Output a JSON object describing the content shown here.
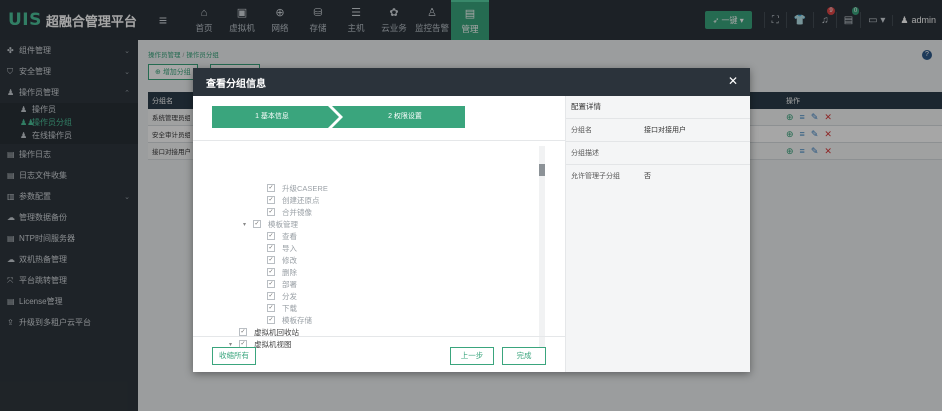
{
  "brand": {
    "logo": "UIS",
    "title": "超融合管理平台"
  },
  "topnav": [
    {
      "label": "首页",
      "icon": "home-icon",
      "glyph": "⌂"
    },
    {
      "label": "虚拟机",
      "icon": "vm-icon",
      "glyph": "▣"
    },
    {
      "label": "网络",
      "icon": "network-icon",
      "glyph": "⊕"
    },
    {
      "label": "存储",
      "icon": "storage-icon",
      "glyph": "⛁"
    },
    {
      "label": "主机",
      "icon": "host-icon",
      "glyph": "☰"
    },
    {
      "label": "云业务",
      "icon": "cloud-icon",
      "glyph": "✿"
    },
    {
      "label": "监控告警",
      "icon": "alarm-icon",
      "glyph": "♙"
    },
    {
      "label": "管理",
      "icon": "manage-icon",
      "glyph": "▤",
      "active": true
    }
  ],
  "topright": {
    "onekey_label": "一键",
    "shirt_badge": "",
    "bell_badge": "9",
    "msg_badge": "0",
    "user": "admin"
  },
  "sidebar": {
    "items": [
      {
        "label": "组件管理",
        "icon": "component-icon",
        "glyph": "✤",
        "chevron": "⌄"
      },
      {
        "label": "安全管理",
        "icon": "security-icon",
        "glyph": "⛉",
        "chevron": "⌄"
      },
      {
        "label": "操作员管理",
        "icon": "operator-icon",
        "glyph": "♟",
        "chevron": "⌃"
      },
      {
        "label": "日志文件收集",
        "icon": "logfile-icon",
        "glyph": "▤"
      },
      {
        "label": "参数配置",
        "icon": "config-icon",
        "glyph": "▥",
        "chevron": "⌄"
      },
      {
        "label": "管理数据备份",
        "icon": "backup-icon",
        "glyph": "☁"
      },
      {
        "label": "NTP时间服务器",
        "icon": "ntp-icon",
        "glyph": "▤"
      },
      {
        "label": "双机热备管理",
        "icon": "ha-icon",
        "glyph": "☁"
      },
      {
        "label": "平台跳转管理",
        "icon": "jump-icon",
        "glyph": "⤧"
      },
      {
        "label": "License管理",
        "icon": "license-icon",
        "glyph": "▤"
      },
      {
        "label": "升级到多租户云平台",
        "icon": "upgrade-icon",
        "glyph": "⇪"
      }
    ],
    "sub": [
      {
        "label": "操作员",
        "glyph": "♟"
      },
      {
        "label": "操作员分组",
        "glyph": "♟♟",
        "active": true
      },
      {
        "label": "在线操作员",
        "glyph": "♟"
      }
    ],
    "log": {
      "label": "操作日志",
      "glyph": "▤"
    }
  },
  "main": {
    "breadcrumb": [
      "操作员管理",
      "操作员分组"
    ],
    "add_label": "增加分组",
    "table_header": "分组名",
    "op_header": "操作",
    "rows": [
      "系统管理员组",
      "安全审计员组",
      "接口对接用户"
    ]
  },
  "modal": {
    "title": "查看分组信息",
    "step1": "1 基本信息",
    "step2": "2 权限设置",
    "tree": [
      {
        "label": "升级CASERE",
        "indent": 2,
        "checked": true
      },
      {
        "label": "创建还原点",
        "indent": 2,
        "checked": true
      },
      {
        "label": "合并镜像",
        "indent": 2,
        "checked": true
      },
      {
        "label": "模板管理",
        "indent": 1,
        "checked": true,
        "toggle": "▾"
      },
      {
        "label": "查看",
        "indent": 2,
        "checked": true
      },
      {
        "label": "导入",
        "indent": 2,
        "checked": true
      },
      {
        "label": "修改",
        "indent": 2,
        "checked": true
      },
      {
        "label": "删除",
        "indent": 2,
        "checked": true
      },
      {
        "label": "部署",
        "indent": 2,
        "checked": true
      },
      {
        "label": "分发",
        "indent": 2,
        "checked": true
      },
      {
        "label": "下载",
        "indent": 2,
        "checked": true
      },
      {
        "label": "模板存储",
        "indent": 2,
        "checked": true
      },
      {
        "label": "虚拟机回收站",
        "indent": 0,
        "checked": true,
        "dark": true
      },
      {
        "label": "虚拟机视图",
        "indent": 0,
        "checked": true,
        "dark": true,
        "toggle": "▾"
      }
    ],
    "collapse_label": "收缩所有",
    "prev_label": "上一步",
    "done_label": "完成",
    "details": {
      "title": "配置详情",
      "rows": [
        {
          "key": "分组名",
          "value": "接口对接用户"
        },
        {
          "key": "分组描述",
          "value": ""
        },
        {
          "key": "允许管理子分组",
          "value": "否"
        }
      ]
    }
  },
  "colors": {
    "accent": "#3aa57d",
    "topbar": "#2b333b",
    "sidebar": "#2f373e"
  }
}
